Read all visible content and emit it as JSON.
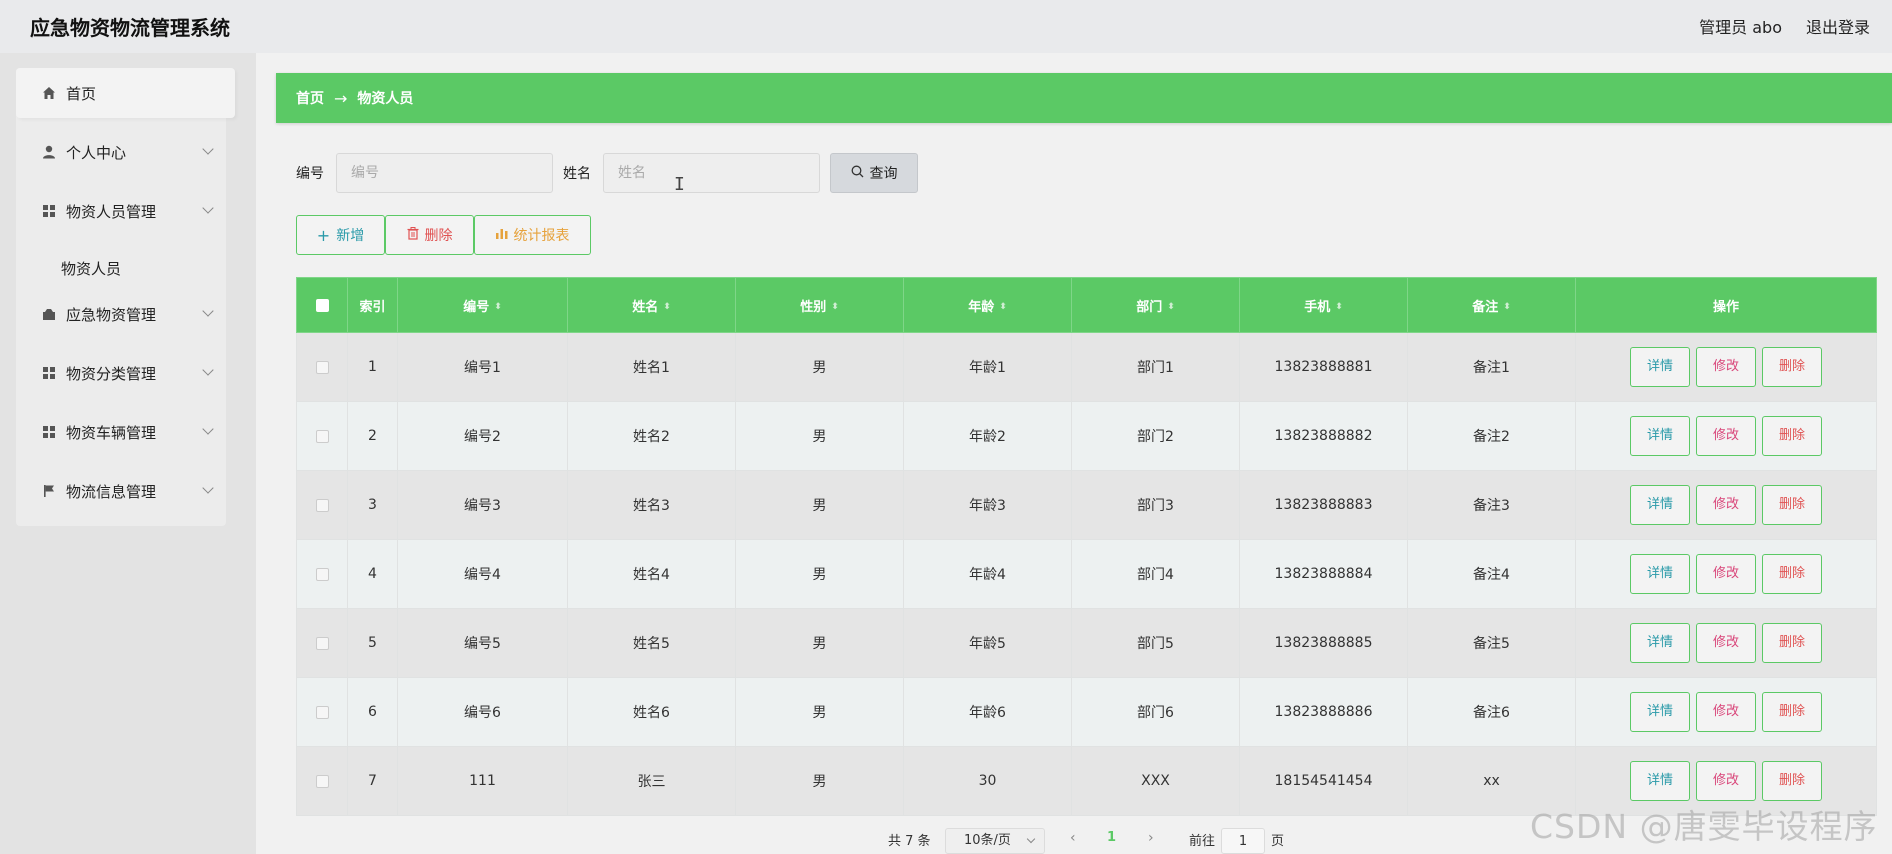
{
  "app": {
    "title": "应急物资物流管理系统"
  },
  "header": {
    "user": "管理员 abo",
    "logout": "退出登录"
  },
  "sidebar": {
    "items": [
      {
        "label": "首页",
        "icon": "home-icon"
      },
      {
        "label": "个人中心",
        "icon": "user-icon"
      },
      {
        "label": "物资人员管理",
        "icon": "grid-icon"
      },
      {
        "label": "应急物资管理",
        "icon": "box-icon"
      },
      {
        "label": "物资分类管理",
        "icon": "grid-icon"
      },
      {
        "label": "物资车辆管理",
        "icon": "grid-icon"
      },
      {
        "label": "物流信息管理",
        "icon": "flag-icon"
      }
    ],
    "sub_item": "物资人员"
  },
  "breadcrumb": {
    "home": "首页",
    "arrow": "→",
    "current": "物资人员"
  },
  "search": {
    "id_label": "编号",
    "id_placeholder": "编号",
    "name_label": "姓名",
    "name_placeholder": "姓名",
    "query_label": "查询"
  },
  "actions": {
    "add": "新增",
    "delete": "删除",
    "report": "统计报表"
  },
  "table": {
    "columns": [
      "索引",
      "编号",
      "姓名",
      "性别",
      "年龄",
      "部门",
      "手机",
      "备注",
      "操作"
    ],
    "rows": [
      [
        "1",
        "编号1",
        "姓名1",
        "男",
        "年龄1",
        "部门1",
        "13823888881",
        "备注1"
      ],
      [
        "2",
        "编号2",
        "姓名2",
        "男",
        "年龄2",
        "部门2",
        "13823888882",
        "备注2"
      ],
      [
        "3",
        "编号3",
        "姓名3",
        "男",
        "年龄3",
        "部门3",
        "13823888883",
        "备注3"
      ],
      [
        "4",
        "编号4",
        "姓名4",
        "男",
        "年龄4",
        "部门4",
        "13823888884",
        "备注4"
      ],
      [
        "5",
        "编号5",
        "姓名5",
        "男",
        "年龄5",
        "部门5",
        "13823888885",
        "备注5"
      ],
      [
        "6",
        "编号6",
        "姓名6",
        "男",
        "年龄6",
        "部门6",
        "13823888886",
        "备注6"
      ],
      [
        "7",
        "111",
        "张三",
        "男",
        "30",
        "XXX",
        "18154541454",
        "xx"
      ]
    ],
    "row_actions": {
      "detail": "详情",
      "edit": "修改",
      "delete": "删除"
    }
  },
  "pagination": {
    "total": "共 7 条",
    "page_size": "10条/页",
    "current_page": "1",
    "goto_prefix": "前往",
    "goto_value": "1",
    "goto_suffix": "页"
  },
  "watermark": "CSDN @唐雯毕设程序"
}
